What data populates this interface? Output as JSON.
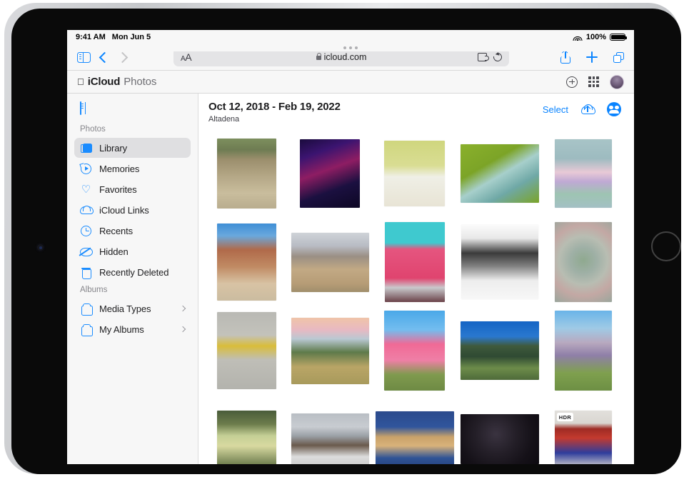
{
  "status_bar": {
    "time": "9:41 AM",
    "date": "Mon Jun 5",
    "battery_percent": "100%",
    "wifi_icon": "wifi-icon",
    "battery_icon": "battery-icon"
  },
  "safari": {
    "sidebar_icon": "sidebar-toggle-icon",
    "back_icon": "chevron-left-icon",
    "forward_icon": "chevron-right-icon",
    "aa_label": "AA",
    "url": "icloud.com",
    "lock_icon": "lock-icon",
    "extensions_icon": "puzzle-extension-icon",
    "reload_icon": "reload-icon",
    "share_icon": "share-icon",
    "new_tab_icon": "plus-icon",
    "tabs_icon": "tabs-overview-icon"
  },
  "app_header": {
    "apple_logo": "",
    "brand": "iCloud",
    "app_name": "Photos",
    "add_icon": "circle-plus-icon",
    "apps_grid_icon": "app-grid-icon",
    "avatar_icon": "user-avatar"
  },
  "sidebar": {
    "collapse_icon": "sidebar-panel-icon",
    "sections": [
      {
        "title": "Photos",
        "items": [
          {
            "label": "Library",
            "icon": "library-icon",
            "active": true,
            "chevron": false
          },
          {
            "label": "Memories",
            "icon": "memories-icon",
            "active": false,
            "chevron": false
          },
          {
            "label": "Favorites",
            "icon": "heart-icon",
            "active": false,
            "chevron": false
          },
          {
            "label": "iCloud Links",
            "icon": "cloud-link-icon",
            "active": false,
            "chevron": false
          },
          {
            "label": "Recents",
            "icon": "clock-icon",
            "active": false,
            "chevron": false
          },
          {
            "label": "Hidden",
            "icon": "eye-slash-icon",
            "active": false,
            "chevron": false
          },
          {
            "label": "Recently Deleted",
            "icon": "trash-icon",
            "active": false,
            "chevron": false
          }
        ]
      },
      {
        "title": "Albums",
        "items": [
          {
            "label": "Media Types",
            "icon": "album-icon",
            "active": false,
            "chevron": true
          },
          {
            "label": "My Albums",
            "icon": "album-icon",
            "active": false,
            "chevron": true
          }
        ]
      }
    ]
  },
  "photos": {
    "title": "Oct 12, 2018 - Feb 19, 2022",
    "subtitle": "Altadena",
    "select_label": "Select",
    "upload_icon": "cloud-upload-icon",
    "share_icon": "shared-album-icon",
    "hdr_badge": "HDR",
    "accent_color": "#0a84ff",
    "grid": [
      [
        {
          "name": "child-with-yellow-float-in-river",
          "w": 83,
          "h": 98,
          "orientation": "portrait"
        },
        {
          "name": "neon-burgers-diner-at-night",
          "w": 84,
          "h": 96,
          "orientation": "portrait"
        },
        {
          "name": "pastries-on-white-plate",
          "w": 85,
          "h": 92,
          "orientation": "landscape"
        },
        {
          "name": "dessert-plate-on-green-cloth",
          "w": 110,
          "h": 82,
          "orientation": "landscape"
        },
        {
          "name": "macarons-flower-arrangement",
          "w": 80,
          "h": 96,
          "orientation": "portrait"
        }
      ],
      [
        {
          "name": "red-rock-canyon-hiker",
          "w": 83,
          "h": 108,
          "orientation": "portrait"
        },
        {
          "name": "desert-boulders-landscape",
          "w": 109,
          "h": 83,
          "orientation": "landscape"
        },
        {
          "name": "pink-frosted-layer-cake",
          "w": 84,
          "h": 112,
          "orientation": "portrait"
        },
        {
          "name": "portrait-black-and-white-smile",
          "w": 108,
          "h": 104,
          "orientation": "square"
        },
        {
          "name": "succulent-echeveria-closeup",
          "w": 80,
          "h": 112,
          "orientation": "portrait"
        }
      ],
      [
        {
          "name": "yellow-gerbera-daisy",
          "w": 83,
          "h": 108,
          "orientation": "portrait"
        },
        {
          "name": "person-in-field-at-sunset",
          "w": 109,
          "h": 93,
          "orientation": "landscape"
        },
        {
          "name": "dancer-in-pink-dress-outdoors",
          "w": 85,
          "h": 112,
          "orientation": "portrait"
        },
        {
          "name": "mountain-pond-with-pines",
          "w": 110,
          "h": 82,
          "orientation": "landscape"
        },
        {
          "name": "portrait-striped-sweater-meadow",
          "w": 80,
          "h": 112,
          "orientation": "portrait"
        }
      ],
      [
        {
          "name": "green-plant-spike-closeup",
          "w": 83,
          "h": 80,
          "orientation": "portrait"
        },
        {
          "name": "portrait-cloudy-sky-background",
          "w": 109,
          "h": 72,
          "orientation": "landscape"
        },
        {
          "name": "perfume-bottle-on-denim",
          "w": 110,
          "h": 78,
          "orientation": "landscape"
        },
        {
          "name": "dark-plums-closeup",
          "w": 110,
          "h": 70,
          "orientation": "landscape"
        },
        {
          "name": "person-in-red-doorway",
          "w": 80,
          "h": 80,
          "orientation": "portrait",
          "hdr": true
        }
      ]
    ]
  }
}
